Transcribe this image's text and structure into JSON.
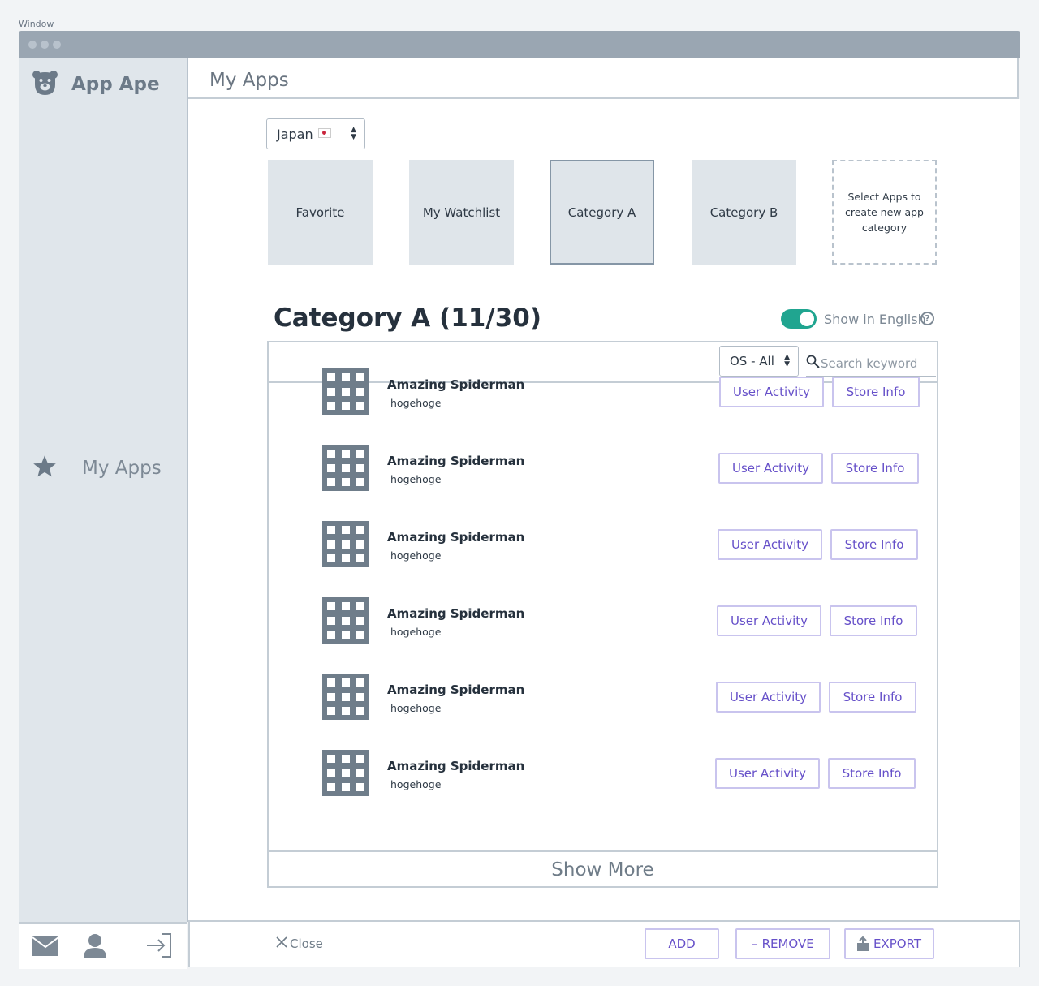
{
  "window": {
    "label": "Window"
  },
  "sidebar": {
    "app_name": "App Ape",
    "nav": [
      {
        "label": "My Apps",
        "icon": "star-icon"
      }
    ],
    "footer_icons": [
      "mail-icon",
      "user-icon",
      "logout-icon"
    ]
  },
  "header": {
    "title": "My Apps"
  },
  "country_select": {
    "value": "Japan"
  },
  "categories": [
    {
      "label": "Favorite"
    },
    {
      "label": "My Watchlist"
    },
    {
      "label": "Category A",
      "active": true
    },
    {
      "label": "Category B"
    },
    {
      "label": "Select Apps to create new app category",
      "dashed": true
    }
  ],
  "section": {
    "title": "Category A (11/30)",
    "toggle_label": "Show in English",
    "toggle_on": true,
    "os_filter": "OS - All",
    "search_placeholder": "Search keyword"
  },
  "apps": [
    {
      "name": "Amazing Spiderman",
      "sub": "hogehoge",
      "btn1": "User Activity",
      "btn2": "Store Info"
    },
    {
      "name": "Amazing Spiderman",
      "sub": "hogehoge",
      "btn1": "User Activity",
      "btn2": "Store Info"
    },
    {
      "name": "Amazing Spiderman",
      "sub": "hogehoge",
      "btn1": "User Activity",
      "btn2": "Store Info"
    },
    {
      "name": "Amazing Spiderman",
      "sub": "hogehoge",
      "btn1": "User Activity",
      "btn2": "Store Info"
    },
    {
      "name": "Amazing Spiderman",
      "sub": "hogehoge",
      "btn1": "User Activity",
      "btn2": "Store Info"
    },
    {
      "name": "Amazing Spiderman",
      "sub": "hogehoge",
      "btn1": "User Activity",
      "btn2": "Store Info"
    }
  ],
  "show_more": "Show More",
  "bottom": {
    "close": "Close",
    "add": "ADD",
    "remove": "– REMOVE",
    "export": "EXPORT"
  },
  "colors": {
    "accent": "#6650c9",
    "toggle": "#20a590",
    "sidebar": "#e0e6eb"
  }
}
